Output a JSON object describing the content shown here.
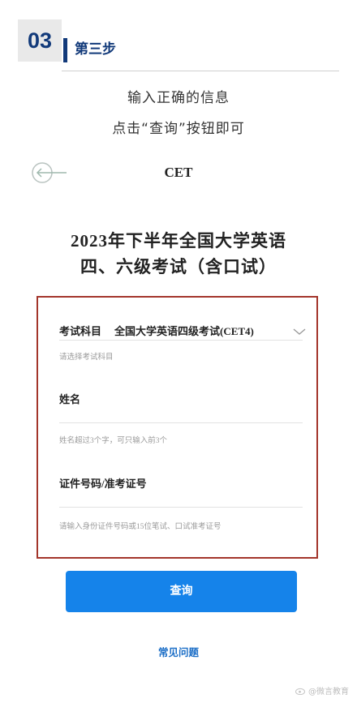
{
  "step": {
    "number": "03",
    "title": "第三步"
  },
  "instructions": {
    "line1": "输入正确的信息",
    "line2": "点击“查询”按钮即可"
  },
  "nav": {
    "site_title": "CET"
  },
  "exam": {
    "title_line1": "2023年下半年全国大学英语",
    "title_line2": "四、六级考试（含口试）"
  },
  "form": {
    "subject": {
      "label": "考试科目",
      "value": "全国大学英语四级考试(CET4)",
      "hint": "请选择考试科目"
    },
    "name": {
      "label": "姓名",
      "value": "",
      "hint": "姓名超过3个字，可只输入前3个"
    },
    "id": {
      "label": "证件号码/准考证号",
      "value": "",
      "hint": "请输入身份证件号码或15位笔试、口试准考证号"
    }
  },
  "buttons": {
    "query": "查询"
  },
  "links": {
    "faq": "常见问题"
  },
  "watermark": {
    "text": "@微言教育"
  },
  "colors": {
    "brand_navy": "#123a7a",
    "primary_button": "#1583ea",
    "highlight_border": "#a3352b",
    "link": "#1d6fc7"
  }
}
